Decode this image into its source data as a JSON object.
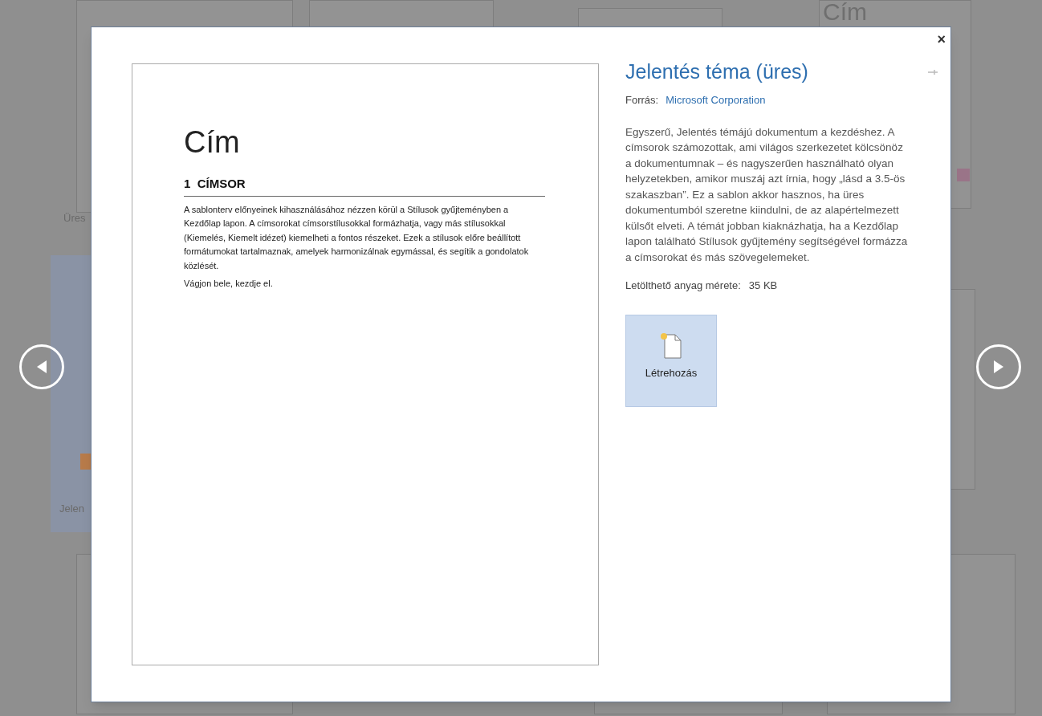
{
  "background": {
    "labels": [
      {
        "text": "Cím",
        "kind": "title"
      },
      {
        "text": "Üres",
        "kind": "caption"
      },
      {
        "text": "Jelen",
        "kind": "caption"
      }
    ]
  },
  "dialog": {
    "close": "×",
    "preview": {
      "title": "Cím",
      "heading": "1  CÍMSOR",
      "paragraphs": [
        "A sablonterv előnyeinek kihasználásához nézzen körül a Stílusok gyűjteményben a Kezdőlap lapon. A címsorokat címsorstílusokkal formázhatja, vagy más stílusokkal (Kiemelés, Kiemelt idézet) kiemelheti a fontos részeket. Ezek a stílusok előre beállított formátumokat tartalmaznak, amelyek harmonizálnak egymással, és segítik a gondolatok közlését.",
        "Vágjon bele, kezdje el."
      ]
    },
    "info": {
      "title": "Jelentés téma (üres)",
      "source_label": "Forrás:",
      "source": "Microsoft Corporation",
      "description": "Egyszerű, Jelentés témájú dokumentum a kezdéshez. A címsorok számozottak, ami világos szerkezetet kölcsönöz a dokumentumnak – és nagyszerűen használható olyan helyzetekben, amikor muszáj azt írnia, hogy „lásd a 3.5-ös szakaszban”. Ez a sablon akkor hasznos, ha üres dokumentumból szeretne kiindulni, de az alapértelmezett külsőt elveti. A témát jobban kiaknázhatja, ha a Kezdőlap lapon található Stílusok gyűjtemény segítségével formázza a címsorokat és más szövegelemeket.",
      "size_label": "Letölthető anyag mérete:",
      "size": "35 KB",
      "create_button": "Létrehozás"
    }
  }
}
